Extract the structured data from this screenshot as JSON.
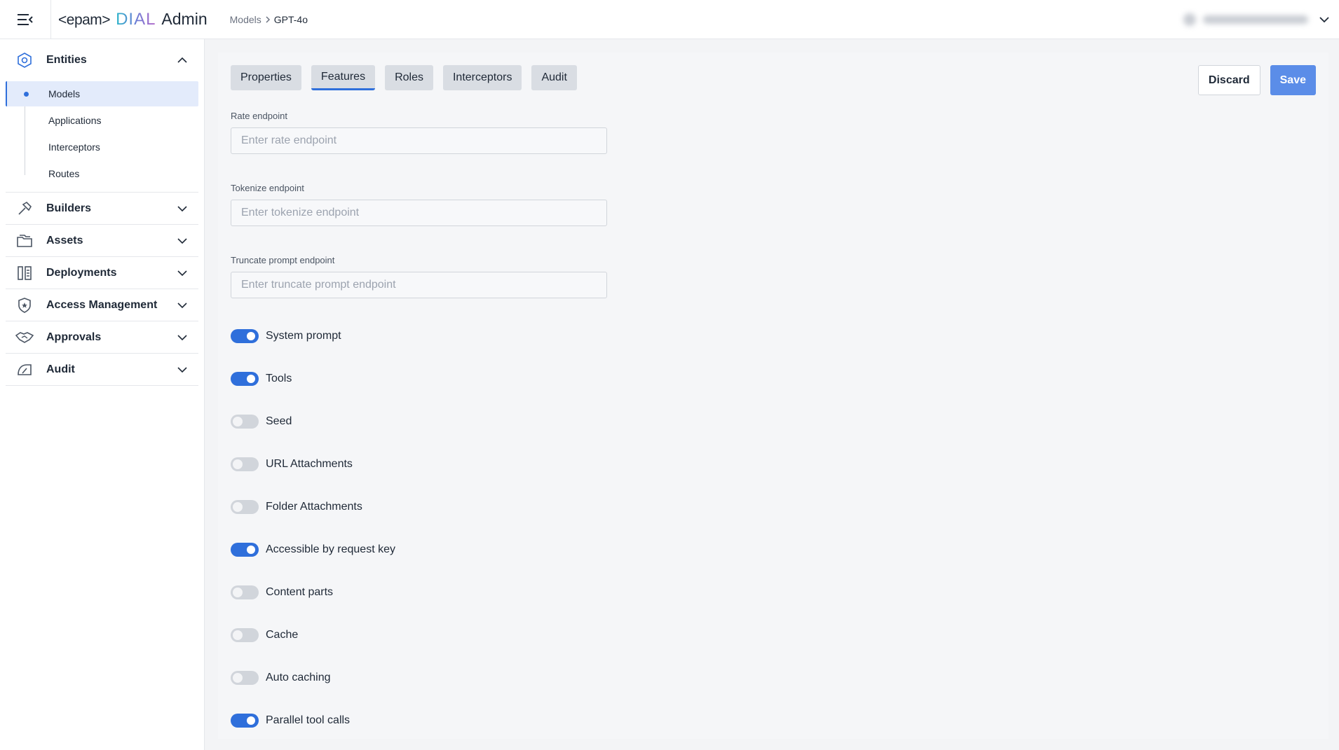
{
  "header": {
    "logo_epam": "<epam>",
    "logo_dial": "DIAL",
    "logo_admin": "Admin",
    "breadcrumb": {
      "parent": "Models",
      "current": "GPT-4o"
    }
  },
  "sidebar": {
    "entities": {
      "label": "Entities",
      "items": [
        "Models",
        "Applications",
        "Interceptors",
        "Routes"
      ],
      "active": "Models"
    },
    "groups": [
      {
        "label": "Builders",
        "icon": "hammer-icon"
      },
      {
        "label": "Assets",
        "icon": "folder-icon"
      },
      {
        "label": "Deployments",
        "icon": "deployments-icon"
      },
      {
        "label": "Access Management",
        "icon": "shield-star-icon"
      },
      {
        "label": "Approvals",
        "icon": "handshake-icon"
      },
      {
        "label": "Audit",
        "icon": "gauge-icon"
      }
    ]
  },
  "tabs": [
    "Properties",
    "Features",
    "Roles",
    "Interceptors",
    "Audit"
  ],
  "active_tab": "Features",
  "actions": {
    "discard": "Discard",
    "save": "Save"
  },
  "fields": [
    {
      "label": "Rate endpoint",
      "value": "",
      "placeholder": "Enter rate endpoint"
    },
    {
      "label": "Tokenize endpoint",
      "value": "",
      "placeholder": "Enter tokenize endpoint"
    },
    {
      "label": "Truncate prompt endpoint",
      "value": "",
      "placeholder": "Enter truncate prompt endpoint"
    }
  ],
  "toggles": [
    {
      "label": "System prompt",
      "on": true
    },
    {
      "label": "Tools",
      "on": true
    },
    {
      "label": "Seed",
      "on": false
    },
    {
      "label": "URL Attachments",
      "on": false
    },
    {
      "label": "Folder Attachments",
      "on": false
    },
    {
      "label": "Accessible by request key",
      "on": true
    },
    {
      "label": "Content parts",
      "on": false
    },
    {
      "label": "Cache",
      "on": false
    },
    {
      "label": "Auto caching",
      "on": false
    },
    {
      "label": "Parallel tool calls",
      "on": true
    }
  ],
  "colors": {
    "accent": "#2f6fdb",
    "save_button": "#5b8de8",
    "active_nav_bg": "#e3ebfb"
  }
}
